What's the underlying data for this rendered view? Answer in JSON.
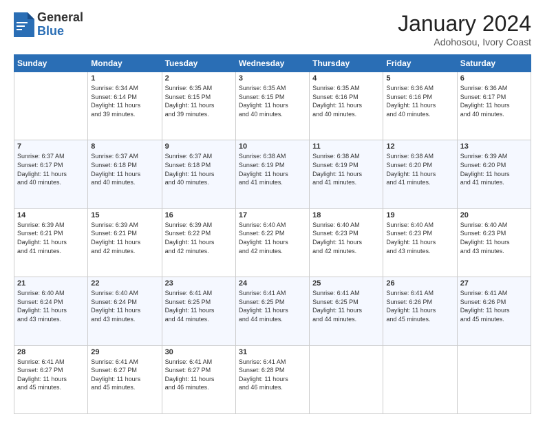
{
  "header": {
    "logo_general": "General",
    "logo_blue": "Blue",
    "month_title": "January 2024",
    "location": "Adohosou, Ivory Coast"
  },
  "days_of_week": [
    "Sunday",
    "Monday",
    "Tuesday",
    "Wednesday",
    "Thursday",
    "Friday",
    "Saturday"
  ],
  "weeks": [
    [
      {
        "day": "",
        "info": ""
      },
      {
        "day": "1",
        "info": "Sunrise: 6:34 AM\nSunset: 6:14 PM\nDaylight: 11 hours\nand 39 minutes."
      },
      {
        "day": "2",
        "info": "Sunrise: 6:35 AM\nSunset: 6:15 PM\nDaylight: 11 hours\nand 39 minutes."
      },
      {
        "day": "3",
        "info": "Sunrise: 6:35 AM\nSunset: 6:15 PM\nDaylight: 11 hours\nand 40 minutes."
      },
      {
        "day": "4",
        "info": "Sunrise: 6:35 AM\nSunset: 6:16 PM\nDaylight: 11 hours\nand 40 minutes."
      },
      {
        "day": "5",
        "info": "Sunrise: 6:36 AM\nSunset: 6:16 PM\nDaylight: 11 hours\nand 40 minutes."
      },
      {
        "day": "6",
        "info": "Sunrise: 6:36 AM\nSunset: 6:17 PM\nDaylight: 11 hours\nand 40 minutes."
      }
    ],
    [
      {
        "day": "7",
        "info": "Sunrise: 6:37 AM\nSunset: 6:17 PM\nDaylight: 11 hours\nand 40 minutes."
      },
      {
        "day": "8",
        "info": "Sunrise: 6:37 AM\nSunset: 6:18 PM\nDaylight: 11 hours\nand 40 minutes."
      },
      {
        "day": "9",
        "info": "Sunrise: 6:37 AM\nSunset: 6:18 PM\nDaylight: 11 hours\nand 40 minutes."
      },
      {
        "day": "10",
        "info": "Sunrise: 6:38 AM\nSunset: 6:19 PM\nDaylight: 11 hours\nand 41 minutes."
      },
      {
        "day": "11",
        "info": "Sunrise: 6:38 AM\nSunset: 6:19 PM\nDaylight: 11 hours\nand 41 minutes."
      },
      {
        "day": "12",
        "info": "Sunrise: 6:38 AM\nSunset: 6:20 PM\nDaylight: 11 hours\nand 41 minutes."
      },
      {
        "day": "13",
        "info": "Sunrise: 6:39 AM\nSunset: 6:20 PM\nDaylight: 11 hours\nand 41 minutes."
      }
    ],
    [
      {
        "day": "14",
        "info": "Sunrise: 6:39 AM\nSunset: 6:21 PM\nDaylight: 11 hours\nand 41 minutes."
      },
      {
        "day": "15",
        "info": "Sunrise: 6:39 AM\nSunset: 6:21 PM\nDaylight: 11 hours\nand 42 minutes."
      },
      {
        "day": "16",
        "info": "Sunrise: 6:39 AM\nSunset: 6:22 PM\nDaylight: 11 hours\nand 42 minutes."
      },
      {
        "day": "17",
        "info": "Sunrise: 6:40 AM\nSunset: 6:22 PM\nDaylight: 11 hours\nand 42 minutes."
      },
      {
        "day": "18",
        "info": "Sunrise: 6:40 AM\nSunset: 6:23 PM\nDaylight: 11 hours\nand 42 minutes."
      },
      {
        "day": "19",
        "info": "Sunrise: 6:40 AM\nSunset: 6:23 PM\nDaylight: 11 hours\nand 43 minutes."
      },
      {
        "day": "20",
        "info": "Sunrise: 6:40 AM\nSunset: 6:23 PM\nDaylight: 11 hours\nand 43 minutes."
      }
    ],
    [
      {
        "day": "21",
        "info": "Sunrise: 6:40 AM\nSunset: 6:24 PM\nDaylight: 11 hours\nand 43 minutes."
      },
      {
        "day": "22",
        "info": "Sunrise: 6:40 AM\nSunset: 6:24 PM\nDaylight: 11 hours\nand 43 minutes."
      },
      {
        "day": "23",
        "info": "Sunrise: 6:41 AM\nSunset: 6:25 PM\nDaylight: 11 hours\nand 44 minutes."
      },
      {
        "day": "24",
        "info": "Sunrise: 6:41 AM\nSunset: 6:25 PM\nDaylight: 11 hours\nand 44 minutes."
      },
      {
        "day": "25",
        "info": "Sunrise: 6:41 AM\nSunset: 6:25 PM\nDaylight: 11 hours\nand 44 minutes."
      },
      {
        "day": "26",
        "info": "Sunrise: 6:41 AM\nSunset: 6:26 PM\nDaylight: 11 hours\nand 45 minutes."
      },
      {
        "day": "27",
        "info": "Sunrise: 6:41 AM\nSunset: 6:26 PM\nDaylight: 11 hours\nand 45 minutes."
      }
    ],
    [
      {
        "day": "28",
        "info": "Sunrise: 6:41 AM\nSunset: 6:27 PM\nDaylight: 11 hours\nand 45 minutes."
      },
      {
        "day": "29",
        "info": "Sunrise: 6:41 AM\nSunset: 6:27 PM\nDaylight: 11 hours\nand 45 minutes."
      },
      {
        "day": "30",
        "info": "Sunrise: 6:41 AM\nSunset: 6:27 PM\nDaylight: 11 hours\nand 46 minutes."
      },
      {
        "day": "31",
        "info": "Sunrise: 6:41 AM\nSunset: 6:28 PM\nDaylight: 11 hours\nand 46 minutes."
      },
      {
        "day": "",
        "info": ""
      },
      {
        "day": "",
        "info": ""
      },
      {
        "day": "",
        "info": ""
      }
    ]
  ]
}
